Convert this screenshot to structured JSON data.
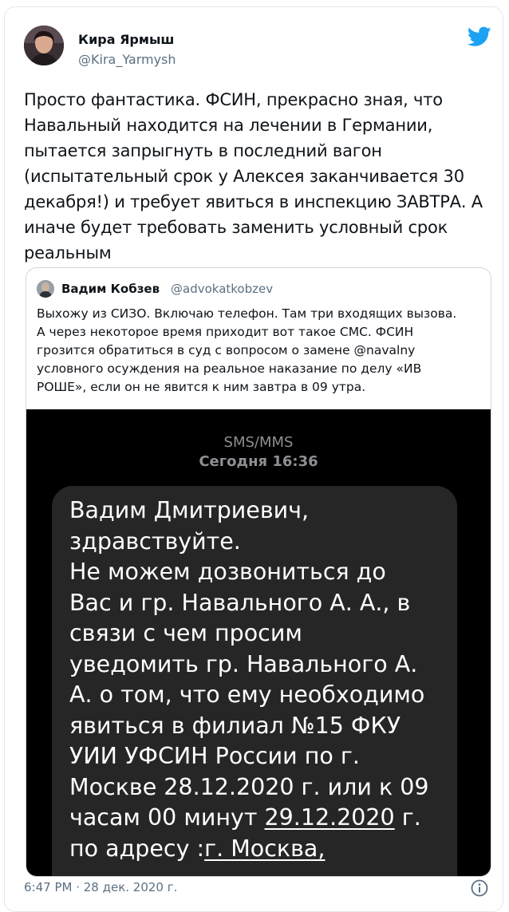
{
  "tweet": {
    "author_name": "Кира Ярмыш",
    "author_handle": "@Kira_Yarmysh",
    "text": "Просто фантастика. ФСИН, прекрасно зная, что\nНавальный находится на лечении в Германии,\nпытается запрыгнуть в последний вагон\n(испытательный срок у Алексея заканчивается 30\nдекабря!) и требует явиться в инспекцию ЗАВТРА. А\nиначе будет требовать заменить условный срок\nреальным",
    "timestamp": "6:47 PM · 28 дек. 2020 г."
  },
  "quoted_tweet": {
    "author_name": "Вадим Кобзев",
    "author_handle": "@advokatkobzev",
    "text": "Выхожу из СИЗО. Включаю телефон. Там три входящих вызова.\nА через некоторое время приходит вот такое СМС. ФСИН\nгрозится обратиться в суд с вопросом о замене @navalny\nусловного осуждения на реальное наказание по делу «ИВ\nРОШЕ», если он не явится к ним завтра в 09 утра."
  },
  "sms": {
    "header_type": "SMS/MMS",
    "header_time": "Сегодня 16:36",
    "body_part1": "Вадим Дмитриевич,\nздравствуйте.\nНе можем дозвониться до\nВас и гр. Навального А. А., в\nсвязи с чем просим\nуведомить гр. Навального А.\nА. о том, что ему необходимо\nявиться в филиал №15 ФКУ\nУИИ УФСИН России по г.\nМоскве 28.12.2020 г. или к 09\nчасам 00 минут ",
    "body_date_link": "29.12.2020",
    "body_part2": " г.\nпо адресу :",
    "body_address_link": "г. Москва,"
  },
  "colors": {
    "brand_blue": "#1da1f2",
    "secondary_text": "#5b7083",
    "border": "#e1e8ed"
  },
  "icons": {
    "logo": "twitter-bird-icon",
    "info": "info-circle-icon"
  }
}
